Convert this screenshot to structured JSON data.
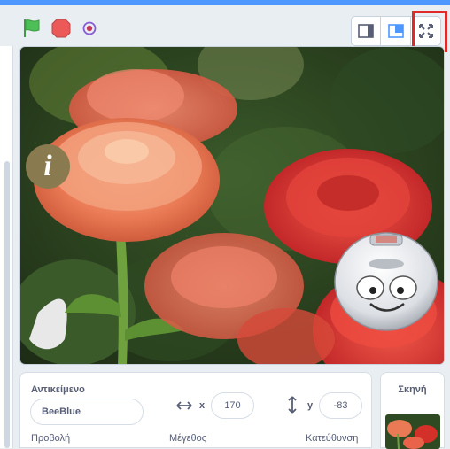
{
  "toolbar": {
    "green_flag_icon": "green-flag-icon",
    "stop_icon": "stop-icon",
    "record_icon": "record-icon",
    "layout_buttons": [
      "small-stage-icon",
      "normal-stage-icon",
      "fullscreen-icon"
    ]
  },
  "stage": {
    "info_glyph": "i",
    "sprite_name_icon": "bee-bot-robot"
  },
  "sprite_info": {
    "object_label": "Αντικείμενο",
    "name_value": "BeeBlue",
    "x_label": "x",
    "x_value": "170",
    "y_label": "y",
    "y_value": "-83",
    "show_label": "Προβολή",
    "size_label": "Μέγεθος",
    "direction_label": "Κατεύθυνση"
  },
  "stage_pane": {
    "title": "Σκηνή"
  },
  "colors": {
    "accent_blue": "#4d97ff",
    "highlight_red": "#e02a2a",
    "flag_green": "#4cbf56",
    "stop_red": "#ec5959"
  }
}
